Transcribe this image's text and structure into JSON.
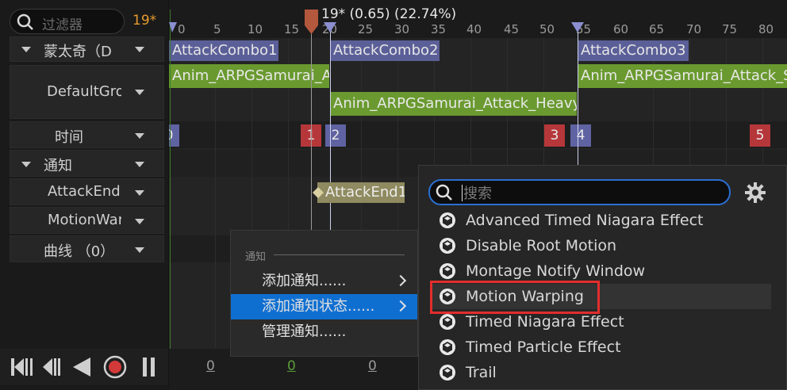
{
  "filter": {
    "placeholder": "过滤器"
  },
  "current_frame_badge": "19*",
  "playhead_label": "19* (0.65) (22.74%)",
  "ruler_ticks": [
    "0",
    "5",
    "10",
    "15",
    "20",
    "25",
    "30",
    "35",
    "40",
    "45",
    "50",
    "55",
    "60",
    "65",
    "70",
    "75",
    "80"
  ],
  "tracks": [
    {
      "label": "蒙太奇（D",
      "has_expander": true
    },
    {
      "label": "DefaultGro",
      "has_expander": false
    },
    {
      "label": "时间",
      "has_expander": false
    },
    {
      "label": "通知",
      "has_expander": true
    },
    {
      "label": "AttackEnd",
      "has_expander": false
    },
    {
      "label": "MotionWar",
      "has_expander": false
    },
    {
      "label": "曲线 （0）",
      "has_expander": false
    }
  ],
  "sections": [
    "AttackCombo1",
    "AttackCombo2",
    "AttackCombo3"
  ],
  "anim_segments": [
    "Anim_ARPGSamurai_A",
    "Anim_ARPGSamurai_Attack_Heavy",
    "Anim_ARPGSamurai_Attack_S"
  ],
  "markers": [
    "0",
    "1",
    "2",
    "3",
    "4",
    "5"
  ],
  "notify_label": "AttackEnd1",
  "bottom_numbers": [
    "0",
    "0",
    "0"
  ],
  "context_menu": {
    "heading": "通知",
    "items": [
      "添加通知......",
      "添加通知状态......",
      "管理通知......"
    ],
    "selected_index": 1
  },
  "submenu": {
    "search_placeholder": "搜索",
    "items": [
      "Advanced Timed Niagara Effect",
      "Disable Root Motion",
      "Montage Notify Window",
      "Motion Warping",
      "Timed Niagara Effect",
      "Timed Particle Effect",
      "Trail"
    ],
    "highlighted_index": 3
  },
  "colors": {
    "section": "#5b5f98",
    "anim": "#6a9a2f",
    "marker_red": "#b6373a",
    "marker_blue": "#5f63a2",
    "selection": "#0f6fd1",
    "frame_badge": "#e59a2e",
    "highlight_box": "#e32d2d"
  }
}
